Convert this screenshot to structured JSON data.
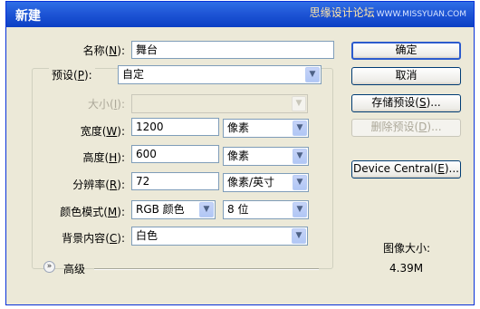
{
  "dialog": {
    "title": "新建",
    "watermark": "思缘设计论坛",
    "watermark_url": "WWW.MISSYUAN.COM"
  },
  "fields": {
    "name": {
      "label": "名称",
      "key": "N",
      "value": "舞台"
    },
    "preset": {
      "label": "预设",
      "key": "P",
      "value": "自定"
    },
    "size": {
      "label": "大小",
      "key": "I",
      "value": ""
    },
    "width": {
      "label": "宽度",
      "key": "W",
      "value": "1200",
      "unit": "像素"
    },
    "height": {
      "label": "高度",
      "key": "H",
      "value": "600",
      "unit": "像素"
    },
    "resolution": {
      "label": "分辨率",
      "key": "R",
      "value": "72",
      "unit": "像素/英寸"
    },
    "color_mode": {
      "label": "颜色模式",
      "key": "M",
      "value": "RGB 颜色",
      "depth": "8 位"
    },
    "background": {
      "label": "背景内容",
      "key": "C",
      "value": "白色"
    }
  },
  "advanced": {
    "label": "高级"
  },
  "buttons": {
    "ok": "确定",
    "cancel": "取消",
    "save_preset": {
      "text": "存储预设",
      "key": "S",
      "suffix": "..."
    },
    "delete_preset": {
      "text": "删除预设",
      "key": "D",
      "suffix": "..."
    },
    "device_central": {
      "text": "Device Central",
      "key": "E",
      "suffix": "..."
    }
  },
  "image_size": {
    "label": "图像大小:",
    "value": "4.39M"
  }
}
